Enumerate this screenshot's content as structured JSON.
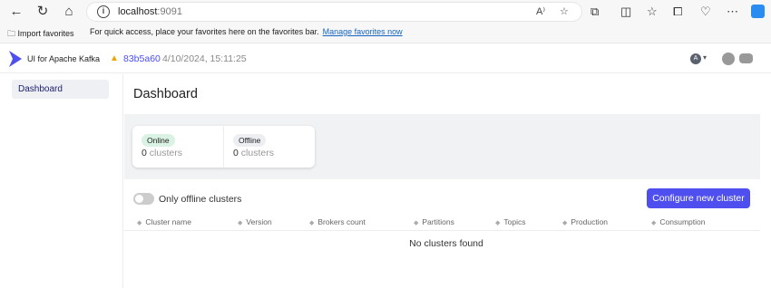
{
  "browser": {
    "url_host": "localhost",
    "url_port": ":9091"
  },
  "favorites_bar": {
    "import_label": "Import favorites",
    "message": "For quick access, place your favorites here on the favorites bar.",
    "manage_link": "Manage favorites now"
  },
  "header": {
    "app_title": "UI for Apache Kafka",
    "commit": "83b5a60",
    "commit_date": "4/10/2024, 15:11:25",
    "user_initial": "A"
  },
  "sidebar": {
    "items": [
      {
        "label": "Dashboard"
      }
    ]
  },
  "main": {
    "title": "Dashboard",
    "stats": [
      {
        "label": "Online",
        "count": "0",
        "unit": "clusters"
      },
      {
        "label": "Offline",
        "count": "0",
        "unit": "clusters"
      }
    ],
    "toggle_label": "Only offline clusters",
    "configure_button": "Configure new cluster",
    "columns": [
      "Cluster name",
      "Version",
      "Brokers count",
      "Partitions",
      "Topics",
      "Production",
      "Consumption"
    ],
    "empty_message": "No clusters found"
  },
  "colors": {
    "accent": "#4f4ff0",
    "online_pill": "#d9f2e3",
    "commit_link": "#4c4cff"
  }
}
